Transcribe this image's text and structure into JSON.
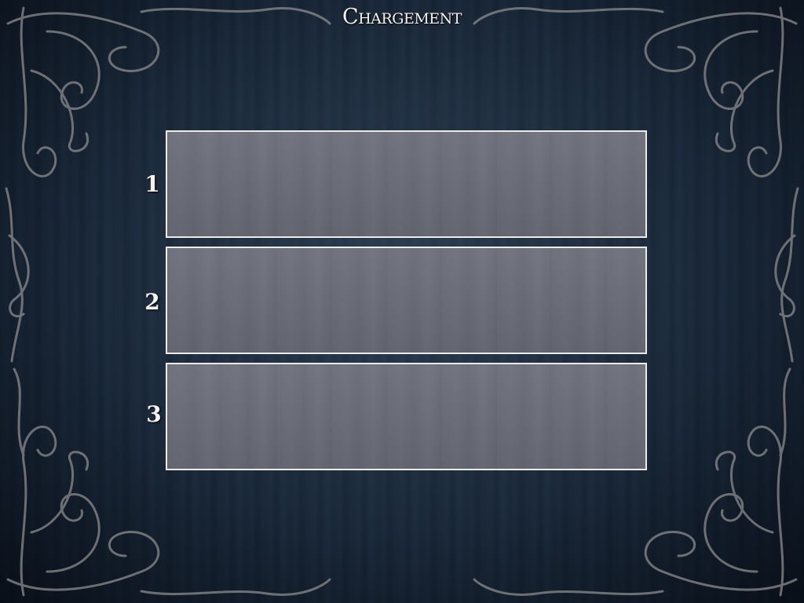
{
  "screen": {
    "title": "Chargement"
  },
  "save_slots": [
    {
      "label": "1"
    },
    {
      "label": "2"
    },
    {
      "label": "3"
    }
  ],
  "colors": {
    "background": "#1a2838",
    "slot_fill": "#6a6d78",
    "slot_border": "#ecebe6",
    "text": "#f2f0ea"
  }
}
